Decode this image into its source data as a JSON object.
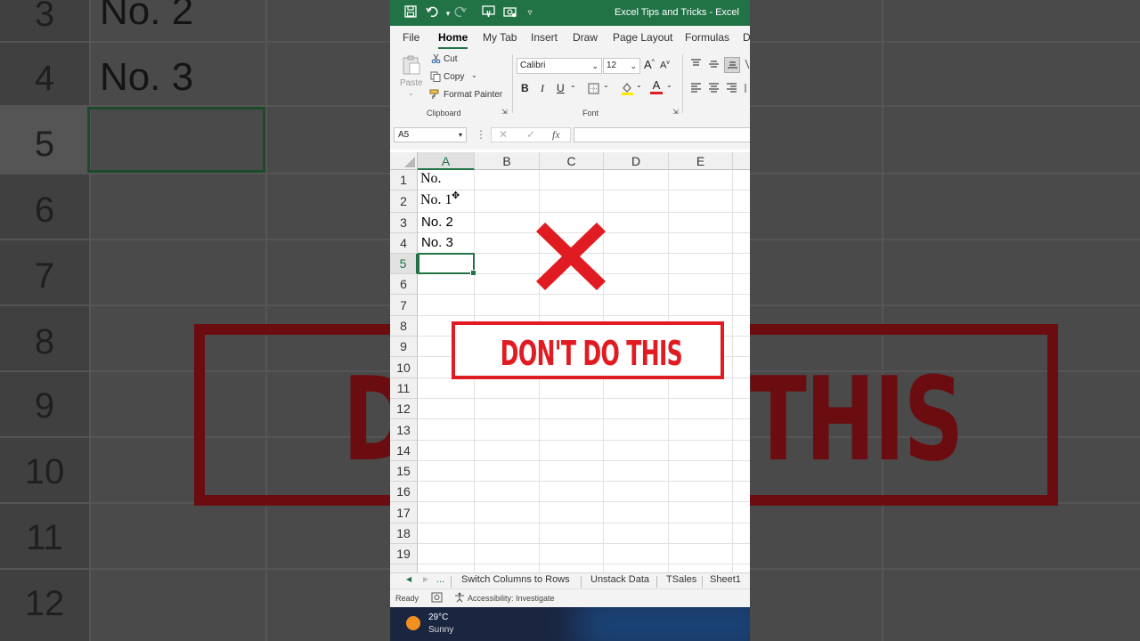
{
  "background_zoom": {
    "row_numbers": [
      "3",
      "4",
      "5",
      "6",
      "7",
      "8",
      "9",
      "10",
      "11",
      "12"
    ],
    "cells": [
      "No. 2",
      "No. 3"
    ],
    "banner_left": "D",
    "banner_right": "THIS"
  },
  "titlebar": {
    "title": "Excel Tips and Tricks  -  Excel"
  },
  "ribbon_tabs": [
    "File",
    "Home",
    "My Tab",
    "Insert",
    "Draw",
    "Page Layout",
    "Formulas",
    "D"
  ],
  "clipboard": {
    "paste": "Paste",
    "cut": "Cut",
    "copy": "Copy",
    "format_painter": "Format Painter",
    "group_label": "Clipboard"
  },
  "font": {
    "name": "Calibri",
    "size": "12",
    "grow": "A",
    "shrink": "A",
    "bold": "B",
    "italic": "I",
    "underline": "U",
    "font_color_letter": "A",
    "group_label": "Font"
  },
  "formula_bar": {
    "name_box": "A5",
    "cancel": "✕",
    "enter": "✓",
    "fx": "fx",
    "value": ""
  },
  "grid": {
    "columns": [
      "A",
      "B",
      "C",
      "D",
      "E"
    ],
    "rows": [
      "1",
      "2",
      "3",
      "4",
      "5",
      "6",
      "7",
      "8",
      "9",
      "10",
      "11",
      "12",
      "13",
      "14",
      "15",
      "16",
      "17",
      "18",
      "19"
    ],
    "cells": {
      "A1": "No.",
      "A2": "No. 1",
      "A3": "No. 2",
      "A4": "No. 3"
    },
    "active_cell": "A5"
  },
  "overlay": {
    "banner_text": "DON'T DO THIS",
    "accent": "#e01c22"
  },
  "sheet_tabs": {
    "nav_ellipsis": "...",
    "tabs": [
      "Switch Columns to Rows",
      "Unstack Data",
      "TSales",
      "Sheet1"
    ]
  },
  "status": {
    "ready": "Ready",
    "accessibility": "Accessibility: Investigate"
  },
  "taskbar": {
    "temperature": "29°C",
    "condition": "Sunny"
  },
  "colors": {
    "excel_green": "#217346",
    "taskbar": "#1a2540"
  }
}
